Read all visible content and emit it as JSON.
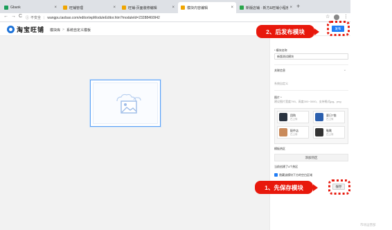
{
  "browser": {
    "tabs": [
      {
        "title": "Gbank",
        "active": false,
        "fav": "#1b9e5a"
      },
      {
        "title": "旺铺管理",
        "active": false,
        "fav": "#f0a500"
      },
      {
        "title": "旺铺-页面装修编辑",
        "active": false,
        "fav": "#f0a500"
      },
      {
        "title": "模块内容编辑",
        "active": true,
        "fav": "#f0a500"
      },
      {
        "title": "新版店铺 · 新方&旺铺小程序",
        "active": false,
        "fav": "#2aa64b"
      }
    ],
    "close_glyph": "×",
    "new_tab_glyph": "+",
    "nav": {
      "back": "←",
      "forward": "→",
      "reload": "C"
    },
    "security_icon": "info-icon",
    "security_label": "不安全",
    "separator": "|",
    "url": "wangpu.taobao.com/editor/wpModuleEditor.htm?moduleId=23288460942",
    "star": "☆",
    "menu": "⋮"
  },
  "app": {
    "logo_text": "淘宝旺铺",
    "breadcrumb": [
      "模块库",
      "系统自定义模板"
    ],
    "breadcrumb_sep": ">",
    "publish_label": "发布"
  },
  "panel": {
    "module_name_label": "* 模块名称",
    "module_name_value": "新版测试模块",
    "bind_label": "关联信息",
    "bind_chev": "⌄",
    "bind_hint": "系统自定义",
    "images_label": "图片 *",
    "images_hint": "建议图片宽度790、高度300~3000、支持格式jpg、png",
    "images": [
      {
        "name": "团购",
        "status": "已上传",
        "color": "#2a3340"
      },
      {
        "name": "夏日T恤",
        "status": "已上传",
        "color": "#2b5fae"
      },
      {
        "name": "配件店",
        "status": "已上传",
        "color": "#c98a5a"
      },
      {
        "name": "鞋靴",
        "status": "已上传",
        "color": "#333333"
      }
    ],
    "hotspot_label": "模板热区",
    "hotspot_button": "添加热区",
    "hotspot_count": "当前创建了4个热区",
    "checkbox_label": "隐藏该模块下方的空白区域",
    "save_label": "保存"
  },
  "annotations": {
    "step1": "1、先保存模块",
    "step2": "2、后发布模块",
    "accent": "#e8180c"
  },
  "corner_text": "市场运营部"
}
